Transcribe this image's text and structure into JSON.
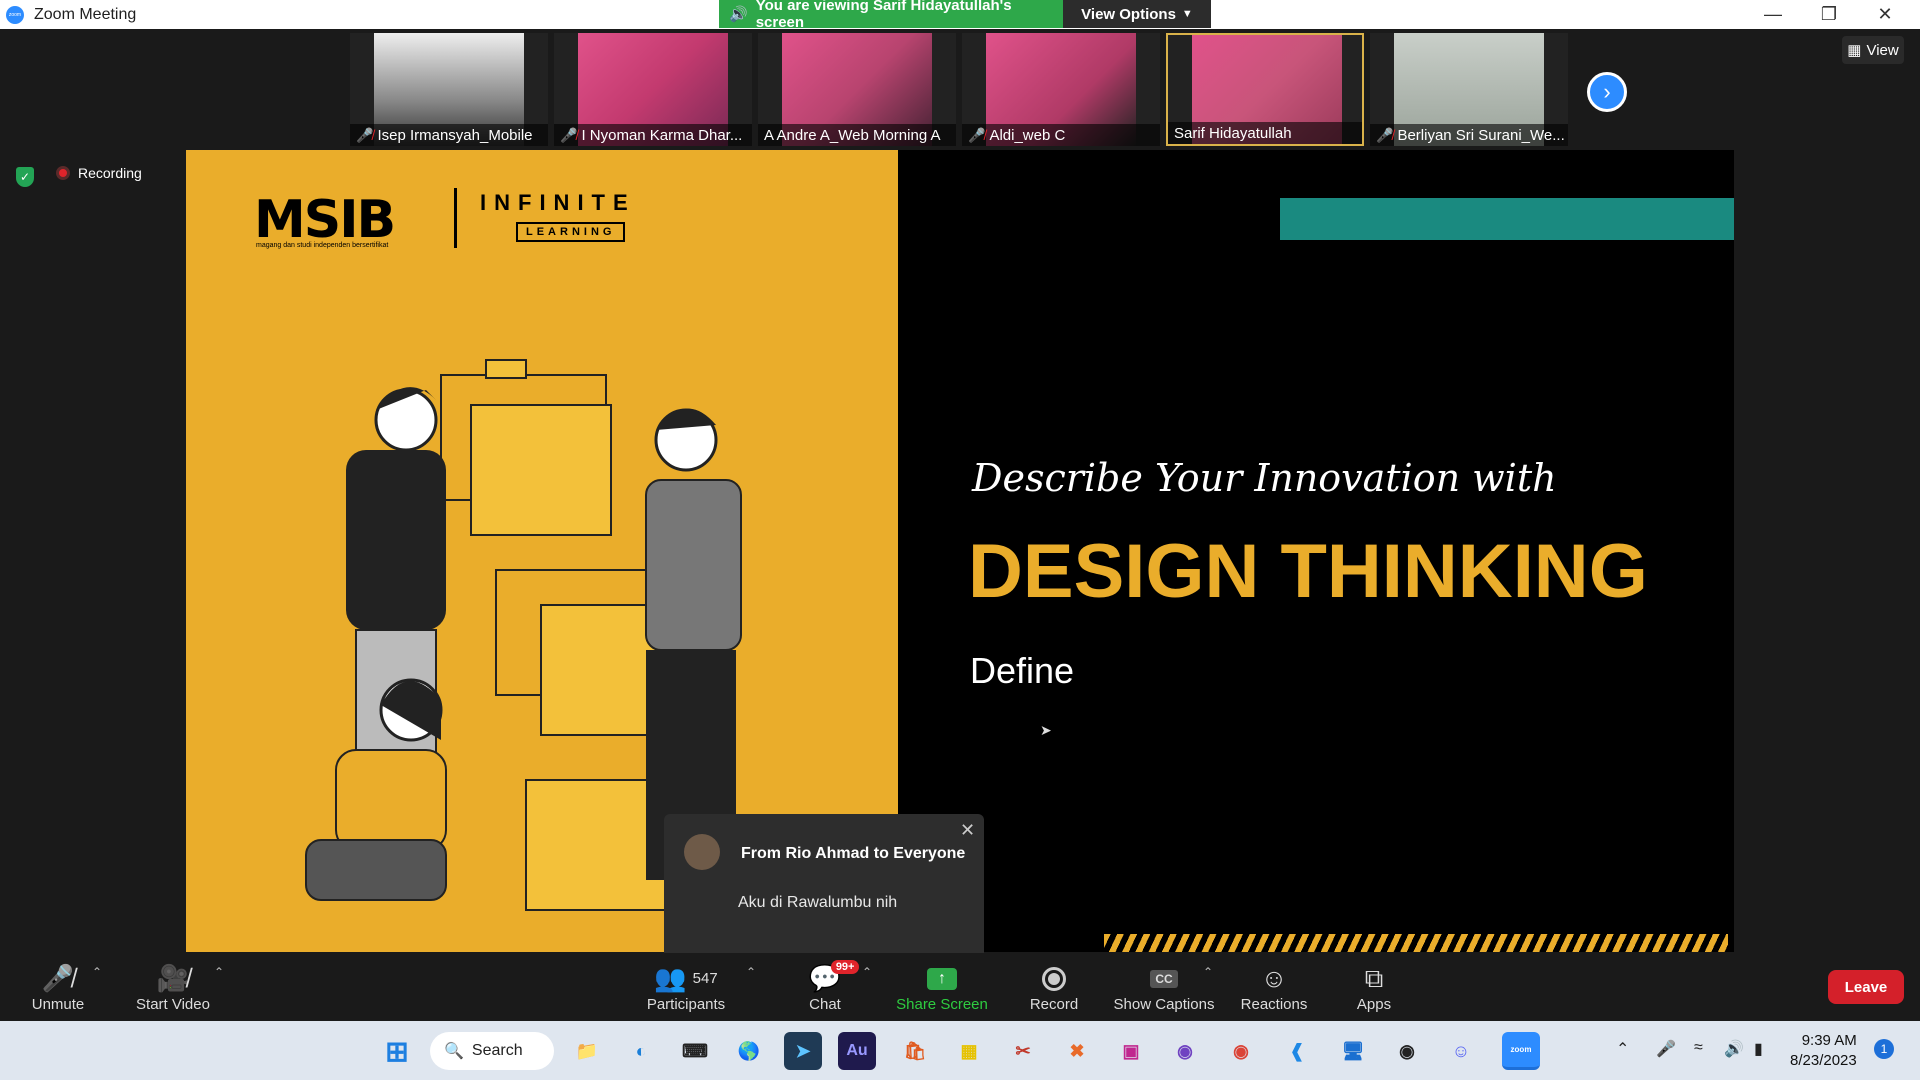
{
  "window": {
    "title": "Zoom Meeting"
  },
  "share_banner": {
    "text": "You are viewing Sarif Hidayatullah's screen",
    "view_options": "View Options"
  },
  "view_button": "View",
  "participants_strip": [
    {
      "name": "Isep Irmansyah_Mobile",
      "muted": true
    },
    {
      "name": "I Nyoman Karma Dhar...",
      "muted": true
    },
    {
      "name": "A Andre A_Web Morning A",
      "muted": false
    },
    {
      "name": "Aldi_web C",
      "muted": true
    },
    {
      "name": "Sarif Hidayatullah",
      "muted": false
    },
    {
      "name": "Berliyan Sri Surani_We...",
      "muted": true
    }
  ],
  "recording": {
    "label": "Recording"
  },
  "slide": {
    "brand": "MSIB",
    "brand_sub": "magang dan studi independen bersertifikat",
    "partner": "INFINITE",
    "partner_sub": "LEARNING",
    "subtitle": "Describe Your Innovation with",
    "title": "DESIGN THINKING",
    "stage": "Define",
    "colors": {
      "accent": "#eaad2b",
      "teal": "#1a8a80"
    }
  },
  "chat_popup": {
    "from": "From Rio Ahmad to Everyone",
    "message": "Aku di Rawalumbu nih"
  },
  "toolbar": {
    "unmute": "Unmute",
    "start_video": "Start Video",
    "participants_count": "547",
    "participants": "Participants",
    "chat_badge": "99+",
    "chat": "Chat",
    "share_screen": "Share Screen",
    "record": "Record",
    "show_captions": "Show Captions",
    "captions_icon": "CC",
    "reactions": "Reactions",
    "apps": "Apps",
    "leave": "Leave"
  },
  "taskbar": {
    "search": "Search",
    "audition_label": "Au",
    "time": "9:39 AM",
    "date": "8/23/2023",
    "notification_count": "1"
  }
}
